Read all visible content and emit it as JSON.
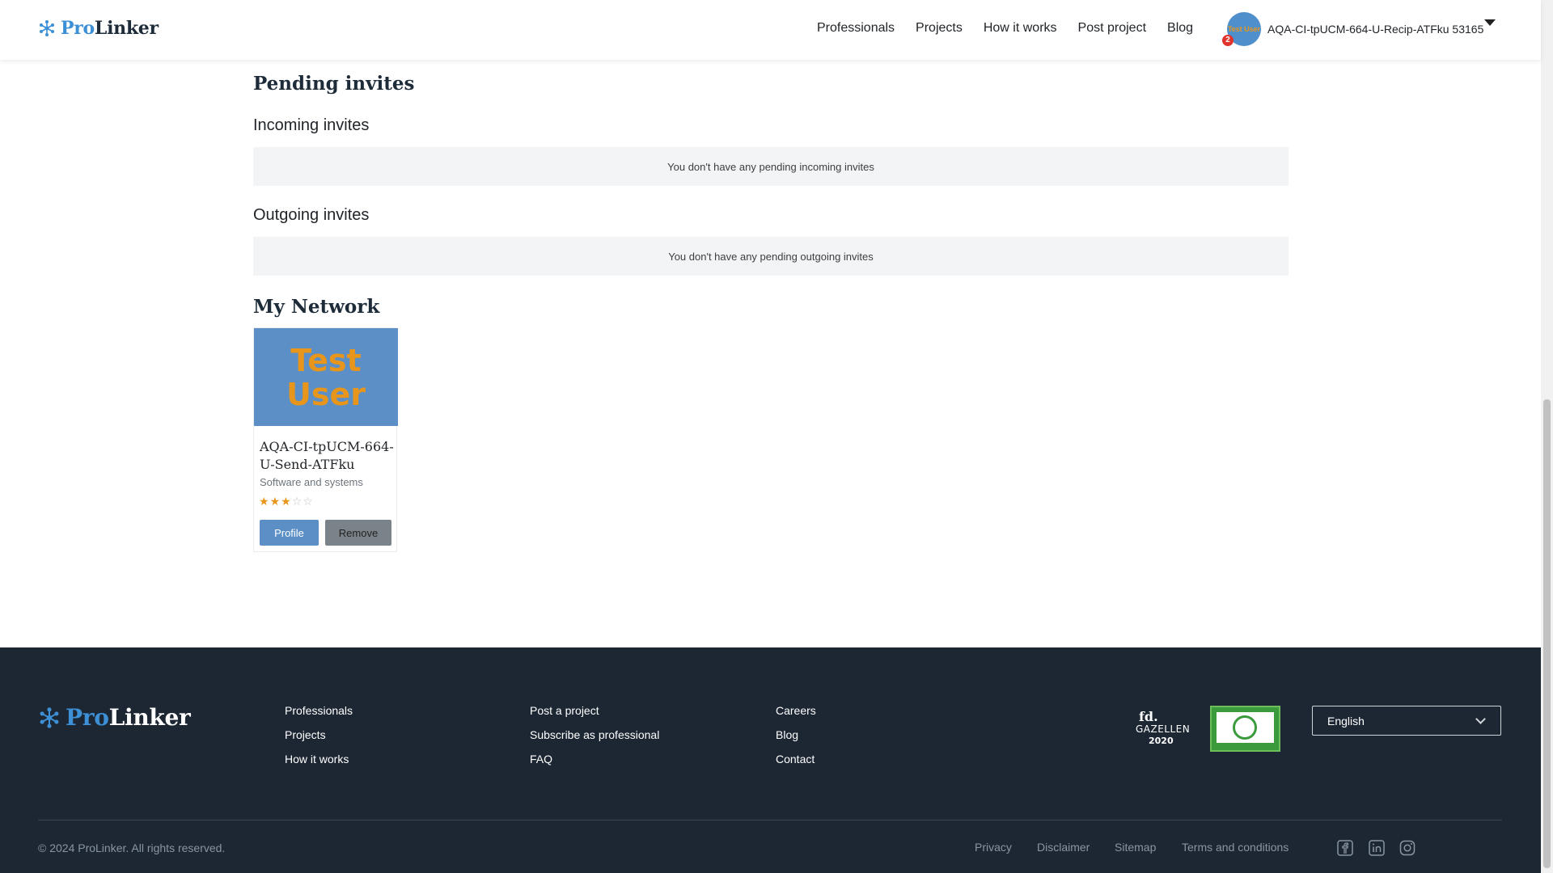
{
  "header": {
    "logo": {
      "pro": "Pro",
      "linker": "Linker"
    },
    "nav": [
      "Professionals",
      "Projects",
      "How it works",
      "Post project",
      "Blog"
    ],
    "user": {
      "name": "AQA-CI-tpUCM-664-U-Recip-ATFku 53165",
      "avatar_text": "Test User",
      "notification_count": "2"
    }
  },
  "main": {
    "pending_title": "Pending invites",
    "incoming_title": "Incoming invites",
    "incoming_empty": "You don't have any pending incoming invites",
    "outgoing_title": "Outgoing invites",
    "outgoing_empty": "You don't have any pending outgoing invites",
    "network_title": "My Network",
    "network": [
      {
        "image_text_line1": "Test",
        "image_text_line2": "User",
        "name": "AQA-CI-tpUCM-664-U-Send-ATFku",
        "category": "Software and systems",
        "rating": 3,
        "rating_max": 5,
        "profile_label": "Profile",
        "remove_label": "Remove"
      }
    ]
  },
  "footer": {
    "logo": {
      "pro": "Pro",
      "linker": "Linker"
    },
    "col1": [
      "Professionals",
      "Projects",
      "How it works"
    ],
    "col2": [
      "Post a project",
      "Subscribe as professional",
      "FAQ"
    ],
    "col3": [
      "Careers",
      "Blog",
      "Contact"
    ],
    "badge_gazellen": {
      "fd": "fd.",
      "name": "GAZELLEN",
      "year": "2020"
    },
    "language": "English",
    "copyright": "© 2024 ProLinker. All rights reserved.",
    "legal": [
      "Privacy",
      "Disclaimer",
      "Sitemap",
      "Terms and conditions"
    ],
    "social_icons": [
      "facebook-icon",
      "linkedin-icon",
      "instagram-icon"
    ]
  },
  "colors": {
    "brand_blue": "#3d8fd6",
    "footer_bg": "#1c2733",
    "star": "#e8961b",
    "profile_button": "#5b8fc5",
    "remove_button": "#7b838a"
  }
}
